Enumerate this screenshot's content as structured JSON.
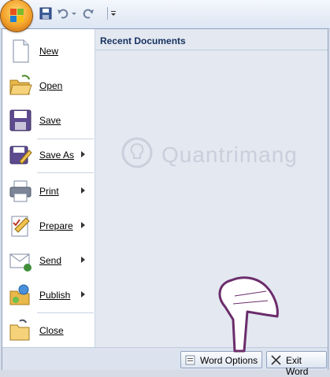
{
  "quick_access": {
    "office_button": "office-button",
    "icons": [
      "save-icon",
      "undo-icon",
      "undo-dropdown-icon",
      "redo-icon",
      "customize-qat-icon"
    ]
  },
  "menu": {
    "items": [
      {
        "label": "New",
        "icon": "new-document-icon",
        "has_submenu": false
      },
      {
        "label": "Open",
        "icon": "open-folder-icon",
        "has_submenu": false
      },
      {
        "label": "Save",
        "icon": "save-disk-icon",
        "has_submenu": false
      },
      {
        "label": "Save As",
        "icon": "save-as-icon",
        "has_submenu": true
      },
      {
        "label": "Print",
        "icon": "printer-icon",
        "has_submenu": true
      },
      {
        "label": "Prepare",
        "icon": "prepare-icon",
        "has_submenu": true
      },
      {
        "label": "Send",
        "icon": "send-icon",
        "has_submenu": true
      },
      {
        "label": "Publish",
        "icon": "publish-icon",
        "has_submenu": true
      },
      {
        "label": "Close",
        "icon": "close-folder-icon",
        "has_submenu": false
      }
    ]
  },
  "recent": {
    "title": "Recent Documents"
  },
  "watermark": {
    "text": "Quantrimang"
  },
  "footer": {
    "word_options": "Word Options",
    "exit_word": "Exit Word"
  },
  "colors": {
    "accent": "#f3a12a",
    "menu_bg": "#eef2f8",
    "panel_bg": "#e3e8f1",
    "title_blue": "#15315e"
  }
}
